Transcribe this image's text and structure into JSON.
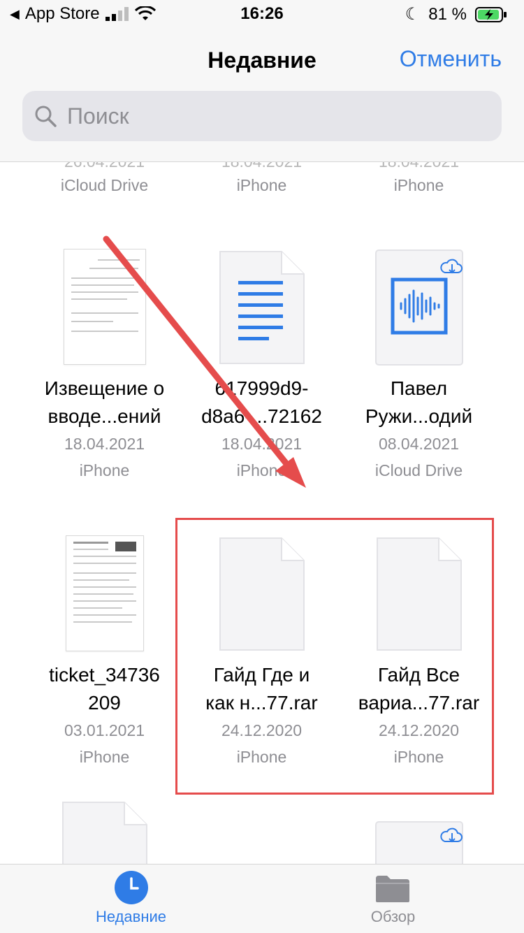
{
  "status_bar": {
    "back_app": "App Store",
    "time": "16:26",
    "battery_percent": "81 %"
  },
  "nav": {
    "title": "Недавние",
    "cancel_label": "Отменить"
  },
  "search": {
    "placeholder": "Поиск"
  },
  "grid": {
    "partial_row": [
      {
        "location": "iCloud Drive"
      },
      {
        "location": "iPhone"
      },
      {
        "location": "iPhone"
      }
    ],
    "row1": [
      {
        "name_line1": "Извещение о",
        "name_line2": "вводе...ений",
        "date": "18.04.2021",
        "location": "iPhone",
        "thumb": "document-preview"
      },
      {
        "name_line1": "617999d9-",
        "name_line2": "d8a6-...72162",
        "date": "18.04.2021",
        "location": "iPhone",
        "thumb": "text-document-icon"
      },
      {
        "name_line1": "Павел",
        "name_line2": "Ружи...одий",
        "date": "08.04.2021",
        "location": "iCloud Drive",
        "thumb": "audio-file-icon"
      }
    ],
    "row2": [
      {
        "name_line1": "ticket_34736",
        "name_line2": "209",
        "date": "03.01.2021",
        "location": "iPhone",
        "thumb": "ticket-preview"
      },
      {
        "name_line1": "Гайд Где и",
        "name_line2": "как н...77.rar",
        "date": "24.12.2020",
        "location": "iPhone",
        "thumb": "blank-file-icon"
      },
      {
        "name_line1": "Гайд Все",
        "name_line2": "вариа...77.rar",
        "date": "24.12.2020",
        "location": "iPhone",
        "thumb": "blank-file-icon"
      }
    ]
  },
  "tab_bar": {
    "tabs": [
      {
        "label": "Недавние",
        "icon": "clock-icon",
        "active": true
      },
      {
        "label": "Обзор",
        "icon": "folder-icon",
        "active": false
      }
    ]
  },
  "colors": {
    "accent": "#2f7ce6",
    "annotation": "#e54c4c",
    "secondary_text": "#8e8e93"
  }
}
